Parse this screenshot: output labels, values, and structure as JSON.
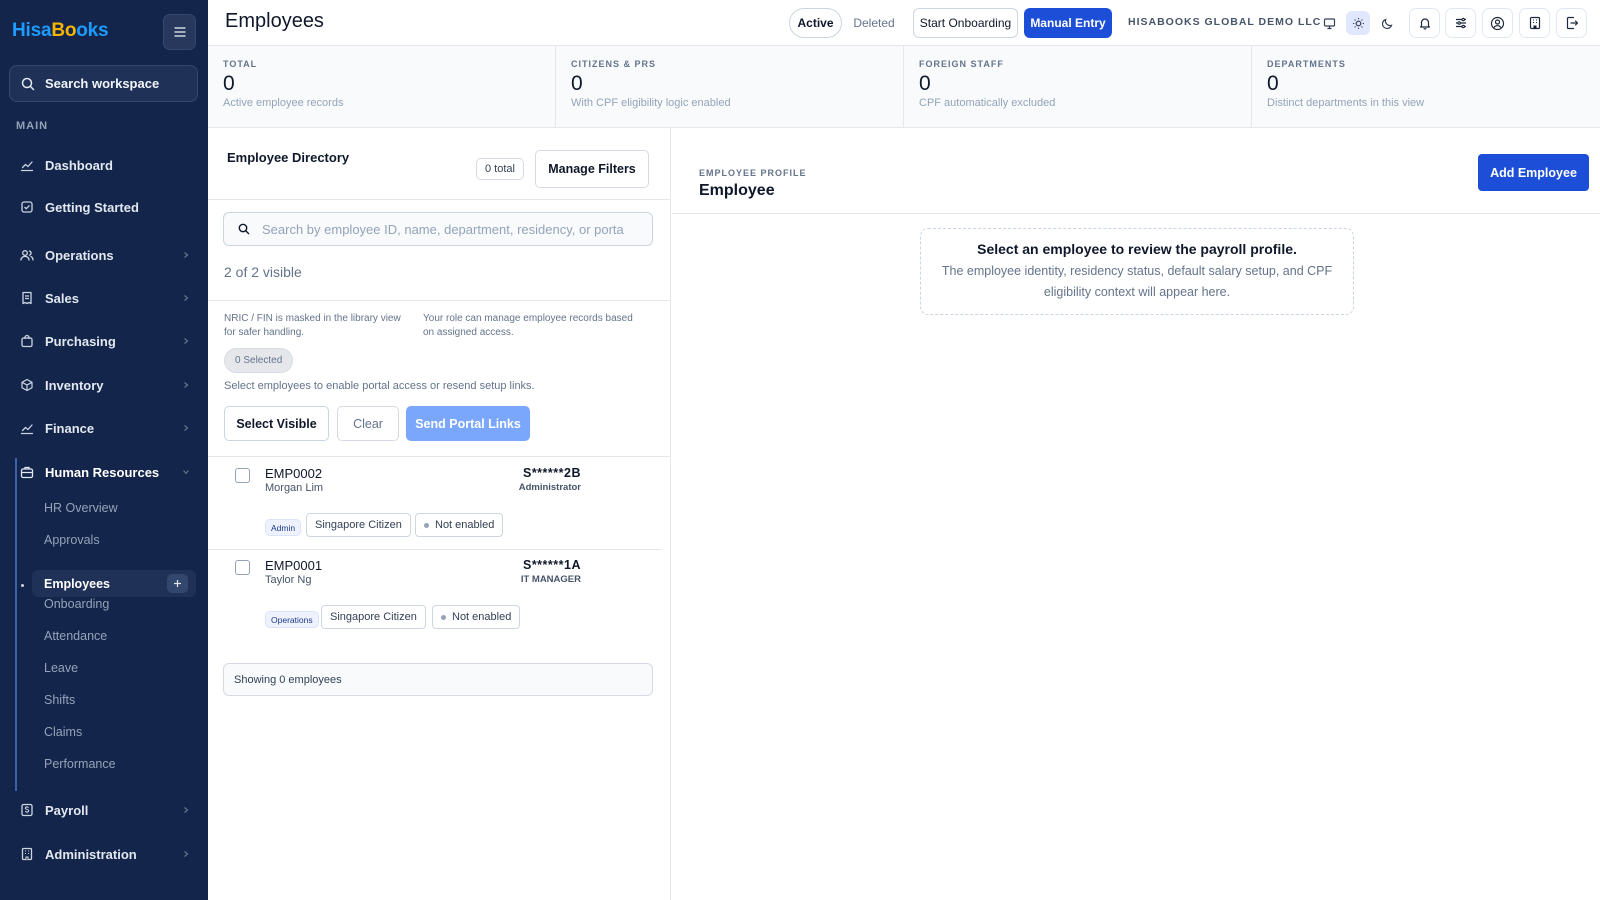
{
  "brand": {
    "part1": "Hisa",
    "part2": "Bo",
    "part3": "oks"
  },
  "sidebar": {
    "search_label": "Search workspace",
    "section_label": "MAIN",
    "items": [
      {
        "label": "Dashboard",
        "icon": "chart-line-icon"
      },
      {
        "label": "Getting Started",
        "icon": "checklist-icon"
      },
      {
        "label": "Operations",
        "icon": "users-icon"
      },
      {
        "label": "Sales",
        "icon": "receipt-icon"
      },
      {
        "label": "Purchasing",
        "icon": "shopping-bag-icon"
      },
      {
        "label": "Inventory",
        "icon": "box-icon"
      },
      {
        "label": "Finance",
        "icon": "chart-line-icon"
      },
      {
        "label": "Human Resources",
        "icon": "briefcase-icon",
        "expanded": true
      },
      {
        "label": "Payroll",
        "icon": "dollar-icon"
      },
      {
        "label": "Administration",
        "icon": "building-icon"
      }
    ],
    "hr_subitems": [
      "HR Overview",
      "Approvals",
      "Employees",
      "Onboarding",
      "Attendance",
      "Leave",
      "Shifts",
      "Claims",
      "Performance"
    ],
    "active_subitem": "Employees"
  },
  "topbar": {
    "title": "Employees",
    "tab_active": "Active",
    "tab_deleted": "Deleted",
    "start_onboarding": "Start Onboarding",
    "manual_entry": "Manual Entry",
    "company": "HISABOOKS GLOBAL DEMO LLC"
  },
  "stats": [
    {
      "label": "TOTAL",
      "value": "0",
      "sub": "Active employee records"
    },
    {
      "label": "CITIZENS & PRS",
      "value": "0",
      "sub": "With CPF eligibility logic enabled"
    },
    {
      "label": "FOREIGN STAFF",
      "value": "0",
      "sub": "CPF automatically excluded"
    },
    {
      "label": "DEPARTMENTS",
      "value": "0",
      "sub": "Distinct departments in this view"
    }
  ],
  "directory": {
    "title": "Employee Directory",
    "total_badge": "0 total",
    "manage_filters": "Manage Filters",
    "search_placeholder": "Search by employee ID, name, department, residency, or porta",
    "visible_count": "2 of 2 visible",
    "note_left": "NRIC / FIN is masked in the library view for safer handling.",
    "note_right": "Your role can manage employee records based on assigned access.",
    "selected_pill": "0 Selected",
    "select_hint": "Select employees to enable portal access or resend setup links.",
    "select_visible": "Select Visible",
    "clear": "Clear",
    "send_portal_links": "Send Portal Links",
    "showing": "Showing 0 employees",
    "employees": [
      {
        "id": "EMP0002",
        "name": "Morgan Lim",
        "nric": "S******2B",
        "role": "Administrator",
        "department": "Admin",
        "residency": "Singapore Citizen",
        "portal": "Not enabled"
      },
      {
        "id": "EMP0001",
        "name": "Taylor Ng",
        "nric": "S******1A",
        "role": "IT MANAGER",
        "department": "Operations",
        "residency": "Singapore Citizen",
        "portal": "Not enabled"
      }
    ]
  },
  "profile": {
    "label": "EMPLOYEE PROFILE",
    "title": "Employee",
    "add_button": "Add Employee",
    "empty_title": "Select an employee to review the payroll profile.",
    "empty_sub": "The employee identity, residency status, default salary setup, and CPF eligibility context will appear here."
  },
  "colors": {
    "sidebar_bg": "#13254a",
    "primary": "#1d4ed8",
    "primary_disabled": "#7aa7fb",
    "logo_blue": "#1e9bff",
    "logo_accent": "#f5b400"
  }
}
